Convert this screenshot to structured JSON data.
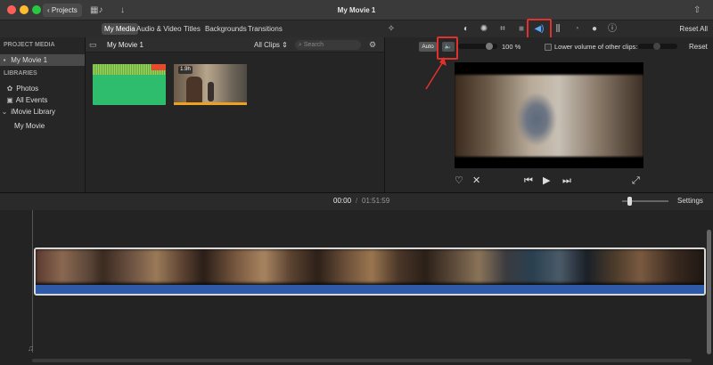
{
  "window": {
    "title": "My Movie 1",
    "projects_button": "Projects"
  },
  "tabs": [
    "My Media",
    "Audio & Video",
    "Titles",
    "Backgrounds",
    "Transitions"
  ],
  "inspector_toolbar": {
    "reset_all": "Reset All"
  },
  "sidebar": {
    "project_media_header": "PROJECT MEDIA",
    "project_item": "My Movie 1",
    "libraries_header": "LIBRARIES",
    "photos": "Photos",
    "all_events": "All Events",
    "library_name": "iMovie Library",
    "event": "My Movie"
  },
  "browser": {
    "title": "My Movie 1",
    "filter": "All Clips",
    "search_placeholder": "Search",
    "clip_duration": "1.9h"
  },
  "volume_controls": {
    "auto": "Auto",
    "volume_percent": "100",
    "percent_sign": "%",
    "volume_level": 1.0,
    "lower_volume_label": "Lower volume of other clips:",
    "reset": "Reset"
  },
  "timeline": {
    "current_time": "00:00",
    "separator": "/",
    "total_time": "01:51:59",
    "settings": "Settings"
  },
  "colors": {
    "highlight": "#e0312c",
    "audio_track": "#2f5aa8",
    "green_clip": "#2ebd6c"
  }
}
